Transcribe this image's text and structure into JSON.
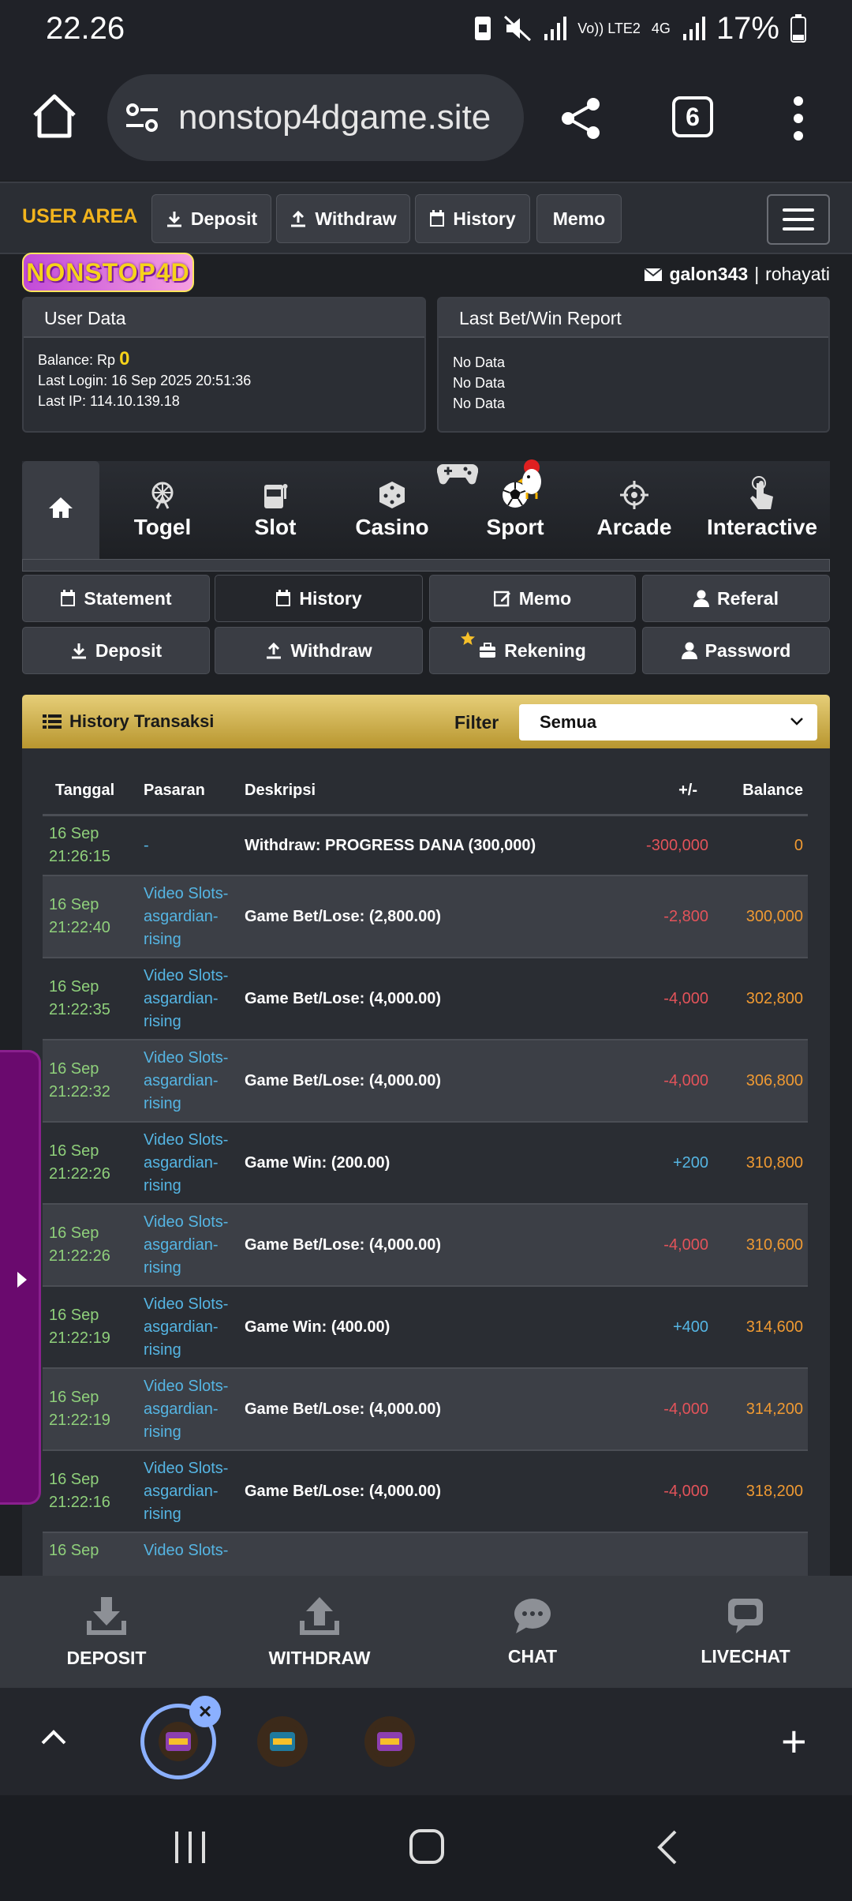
{
  "status": {
    "time": "22.26",
    "network": "Vo)) LTE2",
    "net4g": "4G",
    "battery": "17%"
  },
  "browser": {
    "url": "nonstop4dgame.site",
    "tab_count": "6"
  },
  "nav": {
    "user_area": "USER AREA",
    "buttons": [
      "Deposit",
      "Withdraw",
      "History",
      "Memo"
    ]
  },
  "brand": {
    "logo": "NONSTOP4D"
  },
  "user": {
    "username": "galon343",
    "separator": "|",
    "name": "rohayati"
  },
  "user_data": {
    "title": "User Data",
    "balance_label": "Balance: Rp",
    "balance_value": "0",
    "last_login": "Last Login: 16 Sep 2025 20:51:36",
    "last_ip": "Last IP: 114.10.139.18"
  },
  "last_report": {
    "title": "Last Bet/Win Report",
    "lines": [
      "No Data",
      "No Data",
      "No Data"
    ]
  },
  "game_tabs": [
    "Togel",
    "Slot",
    "Casino",
    "Sport",
    "Arcade",
    "Interactive"
  ],
  "sub_buttons": {
    "row1": [
      "Statement",
      "History",
      "Memo",
      "Referal"
    ],
    "row2": [
      "Deposit",
      "Withdraw",
      "Rekening",
      "Password"
    ]
  },
  "history": {
    "title": "History Transaksi",
    "filter_label": "Filter",
    "filter_value": "Semua",
    "columns": [
      "Tanggal",
      "Pasaran",
      "Deskripsi",
      "+/-",
      "Balance"
    ],
    "rows": [
      {
        "date": "16 Sep",
        "time": "21:26:15",
        "pasaran": [
          "-"
        ],
        "desc": "Withdraw: PROGRESS DANA (300,000)",
        "amount": "-300,000",
        "sign": "neg",
        "balance": "0"
      },
      {
        "date": "16 Sep",
        "time": "21:22:40",
        "pasaran": [
          "Video Slots-",
          "asgardian-",
          "rising"
        ],
        "desc": "Game Bet/Lose: (2,800.00)",
        "amount": "-2,800",
        "sign": "neg",
        "balance": "300,000"
      },
      {
        "date": "16 Sep",
        "time": "21:22:35",
        "pasaran": [
          "Video Slots-",
          "asgardian-",
          "rising"
        ],
        "desc": "Game Bet/Lose: (4,000.00)",
        "amount": "-4,000",
        "sign": "neg",
        "balance": "302,800"
      },
      {
        "date": "16 Sep",
        "time": "21:22:32",
        "pasaran": [
          "Video Slots-",
          "asgardian-",
          "rising"
        ],
        "desc": "Game Bet/Lose: (4,000.00)",
        "amount": "-4,000",
        "sign": "neg",
        "balance": "306,800"
      },
      {
        "date": "16 Sep",
        "time": "21:22:26",
        "pasaran": [
          "Video Slots-",
          "asgardian-",
          "rising"
        ],
        "desc": "Game Win: (200.00)",
        "amount": "+200",
        "sign": "pos",
        "balance": "310,800"
      },
      {
        "date": "16 Sep",
        "time": "21:22:26",
        "pasaran": [
          "Video Slots-",
          "asgardian-",
          "rising"
        ],
        "desc": "Game Bet/Lose: (4,000.00)",
        "amount": "-4,000",
        "sign": "neg",
        "balance": "310,600"
      },
      {
        "date": "16 Sep",
        "time": "21:22:19",
        "pasaran": [
          "Video Slots-",
          "asgardian-",
          "rising"
        ],
        "desc": "Game Win: (400.00)",
        "amount": "+400",
        "sign": "pos",
        "balance": "314,600"
      },
      {
        "date": "16 Sep",
        "time": "21:22:19",
        "pasaran": [
          "Video Slots-",
          "asgardian-",
          "rising"
        ],
        "desc": "Game Bet/Lose: (4,000.00)",
        "amount": "-4,000",
        "sign": "neg",
        "balance": "314,200"
      },
      {
        "date": "16 Sep",
        "time": "21:22:16",
        "pasaran": [
          "Video Slots-",
          "asgardian-",
          "rising"
        ],
        "desc": "Game Bet/Lose: (4,000.00)",
        "amount": "-4,000",
        "sign": "neg",
        "balance": "318,200"
      },
      {
        "date": "16 Sep",
        "time": "",
        "pasaran": [
          "Video Slots-"
        ],
        "desc": "",
        "amount": "",
        "sign": "neg",
        "balance": ""
      }
    ]
  },
  "bottom_nav": [
    "DEPOSIT",
    "WITHDRAW",
    "CHAT",
    "LIVECHAT"
  ],
  "colors": {
    "accent": "#f2b41d",
    "positive": "#55b5e3",
    "negative": "#e3535a",
    "balance": "#f09a32",
    "date": "#8fd07b",
    "side_tab": "#6a0a6e"
  }
}
